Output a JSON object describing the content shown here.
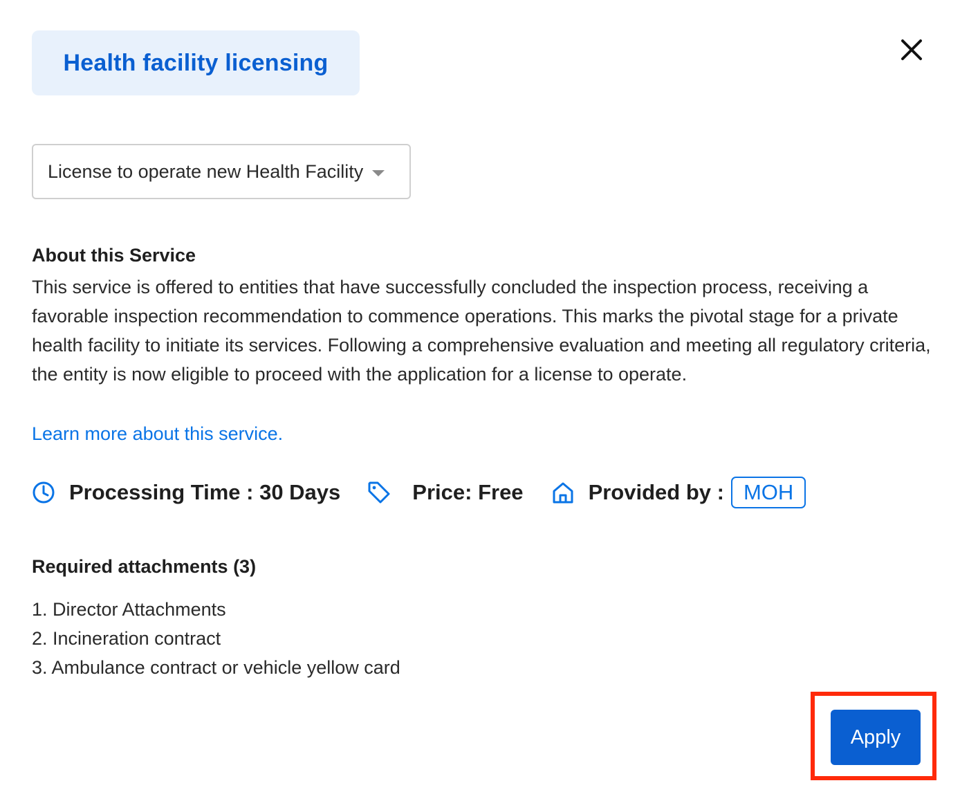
{
  "category": {
    "label": "Health facility licensing"
  },
  "close": {
    "icon": "close-icon"
  },
  "service_select": {
    "selected": "License to operate new Health Facility",
    "icon": "caret-down-icon"
  },
  "about": {
    "title": "About this Service",
    "description": "This service is offered to entities that have successfully concluded the inspection process, receiving a favorable inspection recommendation to commence operations. This marks the pivotal stage for a private health facility to initiate its services. Following a comprehensive evaluation and meeting all regulatory criteria, the entity is now eligible to proceed with the application for a license to operate."
  },
  "learn_more": {
    "label": "Learn more about this service."
  },
  "meta": {
    "processing_time": {
      "icon": "clock-icon",
      "label": "Processing Time : 30 Days"
    },
    "price": {
      "icon": "tag-icon",
      "label": "Price: Free"
    },
    "provider": {
      "icon": "home-icon",
      "label": "Provided by :",
      "badge": "MOH"
    }
  },
  "attachments": {
    "title": "Required attachments (3)",
    "items": [
      "1. Director Attachments",
      "2. Incineration contract",
      "3. Ambulance contract or vehicle yellow card"
    ]
  },
  "actions": {
    "apply_label": "Apply"
  },
  "colors": {
    "accent": "#0a5fd1",
    "link": "#0a74e6",
    "chip_bg": "#e8f1fc",
    "highlight": "#ff2a0a"
  }
}
